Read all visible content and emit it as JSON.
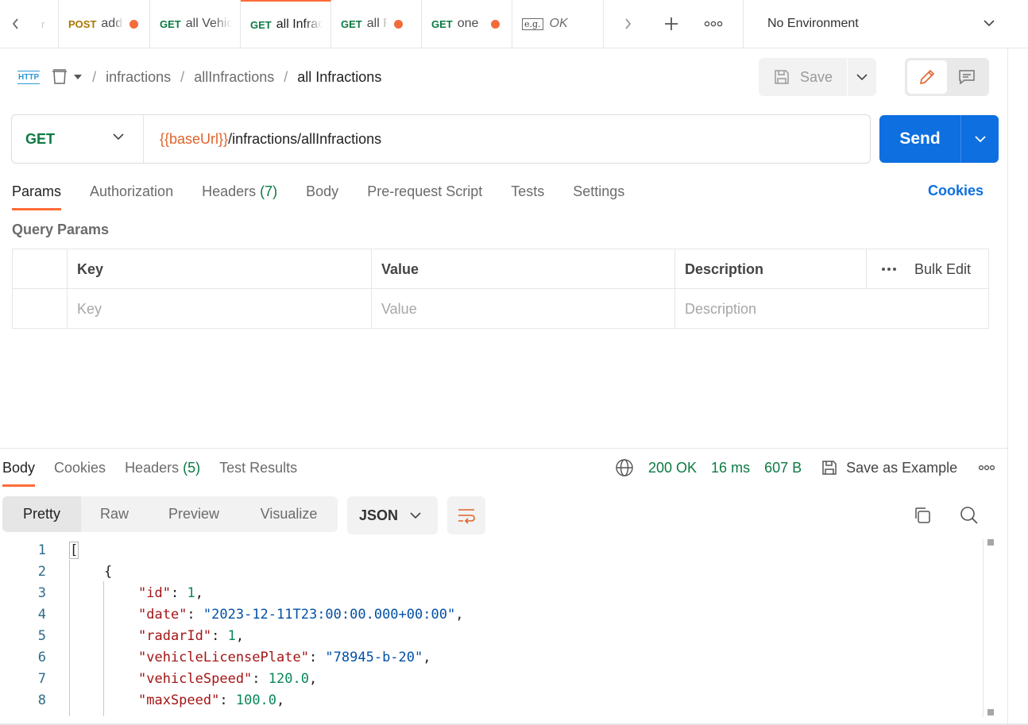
{
  "tabs": [
    {
      "method": "POST",
      "name": "add",
      "dirty": true
    },
    {
      "method": "GET",
      "name": "all Vehicles",
      "dirty": false
    },
    {
      "method": "GET",
      "name": "all Infractions",
      "dirty": false,
      "active": true
    },
    {
      "method": "GET",
      "name": "all Radars",
      "dirty": true
    },
    {
      "method": "GET",
      "name": "one",
      "dirty": true
    }
  ],
  "tab_example": {
    "badge": "e.g.",
    "label": "OK"
  },
  "environment": {
    "label": "No Environment"
  },
  "breadcrumb": {
    "protocol_icon": "HTTP",
    "items": [
      "infractions",
      "allInfractions"
    ],
    "current": "all Infractions"
  },
  "actions": {
    "save_label": "Save"
  },
  "request": {
    "method": "GET",
    "url_variable": "{{baseUrl}}",
    "url_path": "/infractions/allInfractions",
    "send_label": "Send"
  },
  "request_tabs": {
    "params": "Params",
    "authorization": "Authorization",
    "headers": "Headers",
    "headers_count": "(7)",
    "body": "Body",
    "pre_request": "Pre-request Script",
    "tests": "Tests",
    "settings": "Settings",
    "cookies": "Cookies"
  },
  "query_params": {
    "title": "Query Params",
    "headers": {
      "key": "Key",
      "value": "Value",
      "description": "Description",
      "bulk_edit": "Bulk Edit"
    },
    "placeholders": {
      "key": "Key",
      "value": "Value",
      "description": "Description"
    }
  },
  "response": {
    "tabs": {
      "body": "Body",
      "cookies": "Cookies",
      "headers": "Headers",
      "headers_count": "(5)",
      "test_results": "Test Results"
    },
    "status": "200 OK",
    "time": "16 ms",
    "size": "607 B",
    "save_example": "Save as Example",
    "views": [
      "Pretty",
      "Raw",
      "Preview",
      "Visualize"
    ],
    "format": "JSON"
  },
  "code": {
    "line_numbers": [
      "1",
      "2",
      "3",
      "4",
      "5",
      "6",
      "7",
      "8"
    ],
    "open_bracket": "[",
    "open_brace": "{",
    "fields": [
      {
        "key": "\"id\"",
        "value": "1",
        "type": "number"
      },
      {
        "key": "\"date\"",
        "value": "\"2023-12-11T23:00:00.000+00:00\"",
        "type": "string"
      },
      {
        "key": "\"radarId\"",
        "value": "1",
        "type": "number"
      },
      {
        "key": "\"vehicleLicensePlate\"",
        "value": "\"78945-b-20\"",
        "type": "string"
      },
      {
        "key": "\"vehicleSpeed\"",
        "value": "120.0",
        "type": "number"
      },
      {
        "key": "\"maxSpeed\"",
        "value": "100.0",
        "type": "number"
      }
    ]
  },
  "colors": {
    "accent": "#ff6c37",
    "primary": "#0d6fe0",
    "get": "#0c7a43",
    "post": "#ab7600"
  }
}
